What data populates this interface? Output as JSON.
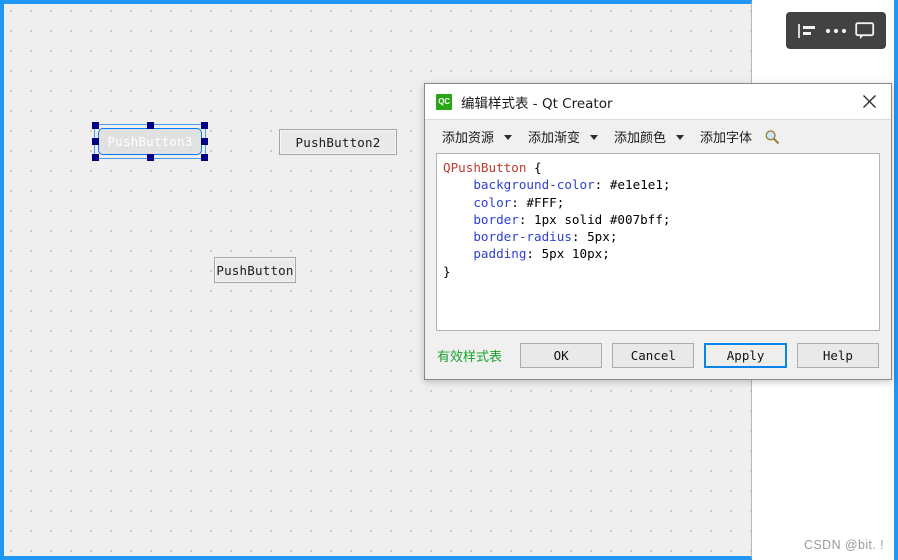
{
  "canvas": {
    "widgets": [
      {
        "name": "pushbutton3",
        "label": "PushButton3",
        "selected": true,
        "style": "styled"
      },
      {
        "name": "pushbutton2",
        "label": "PushButton2",
        "selected": false,
        "style": "plain"
      },
      {
        "name": "pushbutton",
        "label": "PushButton",
        "selected": false,
        "style": "plain"
      }
    ],
    "accent_border_color": "#2196f3",
    "background_color": "#efefef"
  },
  "float_toolbar": {
    "icons": [
      {
        "name": "align-list-icon",
        "title": "align"
      },
      {
        "name": "more-ellipsis-icon",
        "title": "more"
      },
      {
        "name": "comment-bubble-icon",
        "title": "comment"
      }
    ],
    "background_color": "#424242"
  },
  "dialog": {
    "app_icon_text": "QC",
    "title": "编辑样式表 - Qt Creator",
    "close_label": "×",
    "toolbar": {
      "items": [
        {
          "label": "添加资源",
          "has_caret": true
        },
        {
          "label": "添加渐变",
          "has_caret": true
        },
        {
          "label": "添加颜色",
          "has_caret": true
        },
        {
          "label": "添加字体",
          "has_caret": false
        }
      ],
      "font_icon_name": "magnifier-icon"
    },
    "editor": {
      "lines": [
        [
          {
            "t": "QPushButton ",
            "c": "tok-selector"
          },
          {
            "t": "{",
            "c": "tok-plain"
          }
        ],
        [
          {
            "t": "    ",
            "c": "tok-plain"
          },
          {
            "t": "background-color",
            "c": "tok-prop"
          },
          {
            "t": ": #e1e1e1;",
            "c": "tok-plain"
          }
        ],
        [
          {
            "t": "    ",
            "c": "tok-plain"
          },
          {
            "t": "color",
            "c": "tok-prop"
          },
          {
            "t": ": #FFF;",
            "c": "tok-plain"
          }
        ],
        [
          {
            "t": "    ",
            "c": "tok-plain"
          },
          {
            "t": "border",
            "c": "tok-prop"
          },
          {
            "t": ": 1px solid #007bff;",
            "c": "tok-plain"
          }
        ],
        [
          {
            "t": "    ",
            "c": "tok-plain"
          },
          {
            "t": "border-radius",
            "c": "tok-prop"
          },
          {
            "t": ": 5px;",
            "c": "tok-plain"
          }
        ],
        [
          {
            "t": "    ",
            "c": "tok-plain"
          },
          {
            "t": "padding",
            "c": "tok-prop"
          },
          {
            "t": ": 5px 10px;",
            "c": "tok-plain"
          }
        ],
        [
          {
            "t": "}",
            "c": "tok-plain"
          }
        ]
      ],
      "plain_text": "QPushButton {\n    background-color: #e1e1e1;\n    color: #FFF;\n    border: 1px solid #007bff;\n    border-radius: 5px;\n    padding: 5px 10px;\n}"
    },
    "status_label": "有效样式表",
    "status_color": "#1aa12c",
    "buttons": [
      {
        "name": "ok",
        "label": "OK",
        "default": false
      },
      {
        "name": "cancel",
        "label": "Cancel",
        "default": false
      },
      {
        "name": "apply",
        "label": "Apply",
        "default": true
      },
      {
        "name": "help",
        "label": "Help",
        "default": false
      }
    ]
  },
  "watermark": {
    "text": "CSDN @bit. !"
  }
}
